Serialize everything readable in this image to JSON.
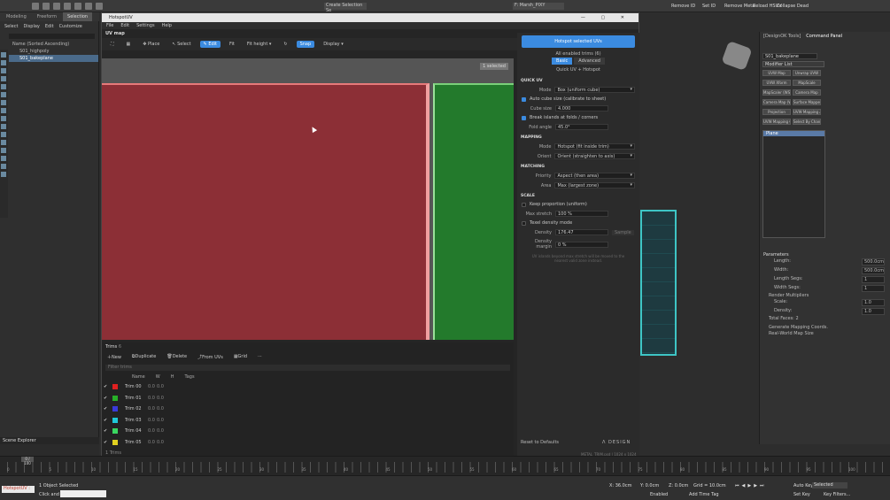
{
  "max": {
    "ribbon_tabs": [
      "Modeling",
      "Freeform",
      "Selection"
    ],
    "create_selection": "Create Selection Se",
    "frame_view": "F: Marsh_PIXY",
    "top_right_buttons": [
      "Remove ID",
      "Set ID",
      "Remove Meta",
      "Reload HSUV",
      "Collapse Dead"
    ],
    "left_menu": [
      "Select",
      "Display",
      "Edit",
      "Customize"
    ],
    "scene_tree": [
      "Name (Sorted Ascending)",
      "S01_highpoly",
      "S01_bakeplane"
    ],
    "scene_explorer": "Scene Explorer",
    "frame_counter": "0 / 100",
    "status_selected": "1 Object Selected",
    "status_hint": "Click and d",
    "script_label": "HotspotUV :",
    "coords": {
      "x": "X: 36.0cm",
      "y": "Y: 0.0cm",
      "z": "Z: 0.0cm",
      "grid": "Grid = 10.0cm"
    },
    "add_time_tag": "Add Time Tag",
    "auto_key": "Auto Key",
    "selected_dd": "Selected",
    "set_key": "Set Key",
    "key_filters": "Key Filters...",
    "enabled": "Enabled",
    "timeline_ticks": [
      "0",
      "5",
      "10",
      "15",
      "20",
      "25",
      "30",
      "35",
      "40",
      "45",
      "50",
      "55",
      "60",
      "65",
      "70",
      "75",
      "80",
      "85",
      "90",
      "95",
      "100"
    ]
  },
  "right_panel": {
    "tabs": [
      "[DesignOK Tools]",
      "Command Panel"
    ],
    "object_name": "S01_bakeplane",
    "modifier_list": "Modifier List",
    "buttons": [
      "UVW Map",
      "Unwrap UVW",
      "UVW Xform",
      "MapScale",
      "MapScaler (WSM)",
      "Camera Map",
      "Camera Map (WSM)",
      "Surface Mapper (WSM)",
      "Projection",
      "UVW Mapping Add",
      "UVW Mapping Clear",
      "Select By Channel"
    ],
    "stack_item": "Plane",
    "params_title": "Parameters",
    "params": [
      {
        "l": "Length:",
        "v": "500.0cm"
      },
      {
        "l": "Width:",
        "v": "500.0cm"
      },
      {
        "l": "Length Segs:",
        "v": "1"
      },
      {
        "l": "Width Segs:",
        "v": "1"
      }
    ],
    "render_mult": "Render Multipliers",
    "scale": {
      "l": "Scale:",
      "v": "1.0"
    },
    "density": {
      "l": "Density:",
      "v": "1.0"
    },
    "total_faces": "Total Faces: 2",
    "gen_coords": "Generate Mapping Coords.",
    "real_world": "Real-World Map Size"
  },
  "hotspot": {
    "title": "HotspotUV",
    "menu": [
      "File",
      "Edit",
      "Settings",
      "Help"
    ],
    "uv_header": "UV map",
    "toolbar": [
      "Place",
      "Select",
      "Edit",
      "Fit",
      "Fit height",
      "Snap",
      "Display"
    ],
    "badge": "1 selected",
    "trims_title": "Trims",
    "trims_count": "6",
    "trim_actions": [
      "New",
      "Duplicate",
      "Delete",
      "From UVs",
      "Grid"
    ],
    "search_placeholder": "Filter trims",
    "trim_columns": [
      "Name",
      "W",
      "H",
      "Tags"
    ],
    "trims": [
      {
        "name": "Trim 00",
        "color": "#e02020",
        "w": "0.0",
        "h": "0.0"
      },
      {
        "name": "Trim 01",
        "color": "#28b028",
        "w": "0.0",
        "h": "0.0"
      },
      {
        "name": "Trim 02",
        "color": "#3a3ad8",
        "w": "0.0",
        "h": "0.0"
      },
      {
        "name": "Trim 03",
        "color": "#20c8d8",
        "w": "0.0",
        "h": "0.0"
      },
      {
        "name": "Trim 04",
        "color": "#3ad860",
        "w": "0.0",
        "h": "0.0"
      },
      {
        "name": "Trim 05",
        "color": "#e0d020",
        "w": "0.0",
        "h": "0.0"
      }
    ],
    "footer_left": "1 Trims",
    "footer_right": "METAL_TRIM.psd | 1024 x 1024",
    "hotspot_btn": "Hotspot selected UVs",
    "enabled_trims": "All enabled trims (6)",
    "tab_basic": "Basic",
    "tab_adv": "Advanced",
    "quick_link": "Quick UV + Hotspot",
    "quick_uv": "QUICK UV",
    "mode_lbl": "Mode",
    "mode_val": "Box (uniform cube)",
    "auto_cube": "Auto cube size (calibrate to sheet)",
    "cube_lbl": "Cube size",
    "cube_val": "4.000",
    "break_islands": "Break islands at folds / corners",
    "fold_lbl": "Fold angle",
    "fold_val": "45.0°",
    "mapping": "MAPPING",
    "map_mode_val": "Hotspot (fit inside trim)",
    "orient_lbl": "Orient",
    "orient_val": "Orient (straighten to axis)",
    "matching": "MATCHING",
    "priority_lbl": "Priority",
    "priority_val": "Aspect (then area)",
    "area_lbl": "Area",
    "area_val": "Max (largest zone)",
    "scale_sect": "SCALE",
    "keep_prop": "Keep proportion (uniform)",
    "max_stretch_lbl": "Max stretch",
    "max_stretch_val": "100 %",
    "texel": "Texel density mode",
    "density_lbl": "Density",
    "density_val": "176.47",
    "sample": "Sample",
    "margin_lbl": "Density margin",
    "margin_val": "0 %",
    "note": "UV islands beyond max stretch will be moved to the nearest valid zone instead.",
    "reset": "Reset to Defaults",
    "brand": "Λ DESIGN"
  }
}
